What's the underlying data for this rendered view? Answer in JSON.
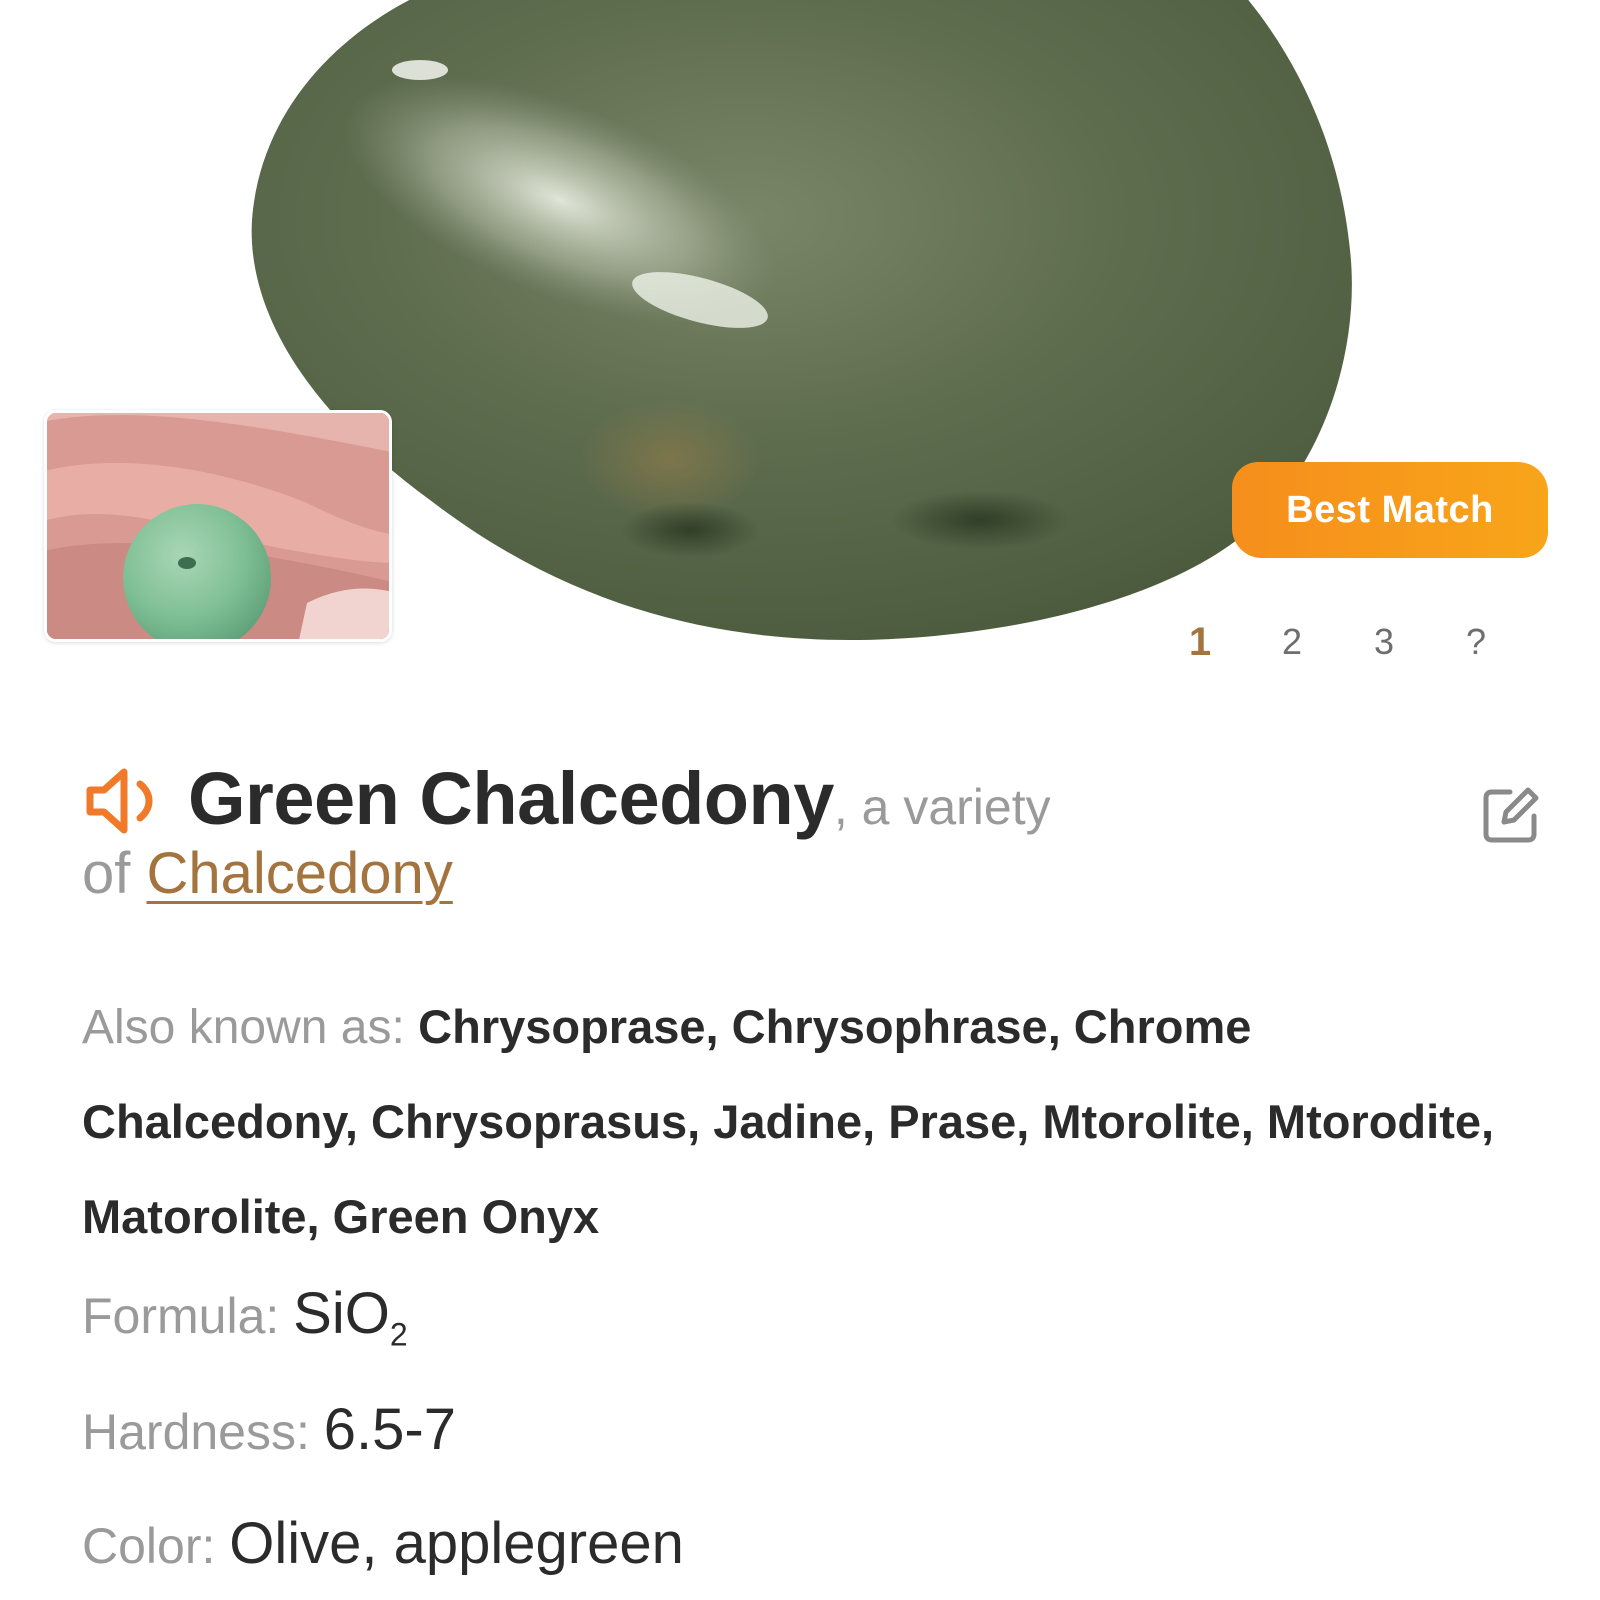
{
  "hero": {
    "badge_label": "Best Match",
    "pager": [
      "1",
      "2",
      "3",
      "?"
    ],
    "active_page": "1"
  },
  "header": {
    "mineral_name": "Green Chalcedony",
    "variety_text": ", a variety",
    "of_text": "of ",
    "parent_name": "Chalcedony"
  },
  "properties": {
    "aka_label": "Also known as: ",
    "aka_value": "Chrysoprase, Chrysophrase, Chrome Chalcedony, Chrysoprasus, Jadine, Prase, Mtorolite, Mtorodite, Matorolite, Green Onyx",
    "formula_label": "Formula: ",
    "formula_main": "SiO",
    "formula_sub": "2",
    "hardness_label": "Hardness: ",
    "hardness_value": "6.5-7",
    "color_label": "Color: ",
    "color_value": "Olive, applegreen"
  },
  "icons": {
    "speaker": "speaker-icon",
    "edit": "edit-icon"
  },
  "colors": {
    "accent_orange": "#f68e1c",
    "link_brown": "#a4743f",
    "stone_green": "#5f6e50",
    "text_dark": "#2b2b2b",
    "text_muted": "#9a9a9a"
  }
}
